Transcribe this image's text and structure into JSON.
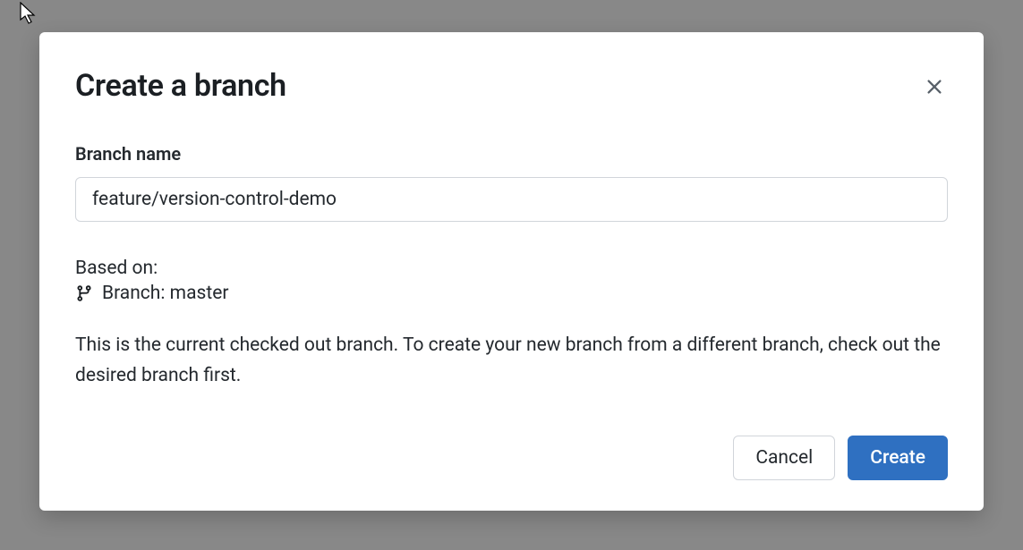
{
  "modal": {
    "title": "Create a branch",
    "branch_name_label": "Branch name",
    "branch_name_value": "feature/version-control-demo",
    "based_on_label": "Based on:",
    "based_on_branch": "Branch: master",
    "description": "This is the current checked out branch. To create your new branch from a different branch, check out the desired branch first.",
    "cancel_label": "Cancel",
    "create_label": "Create"
  }
}
